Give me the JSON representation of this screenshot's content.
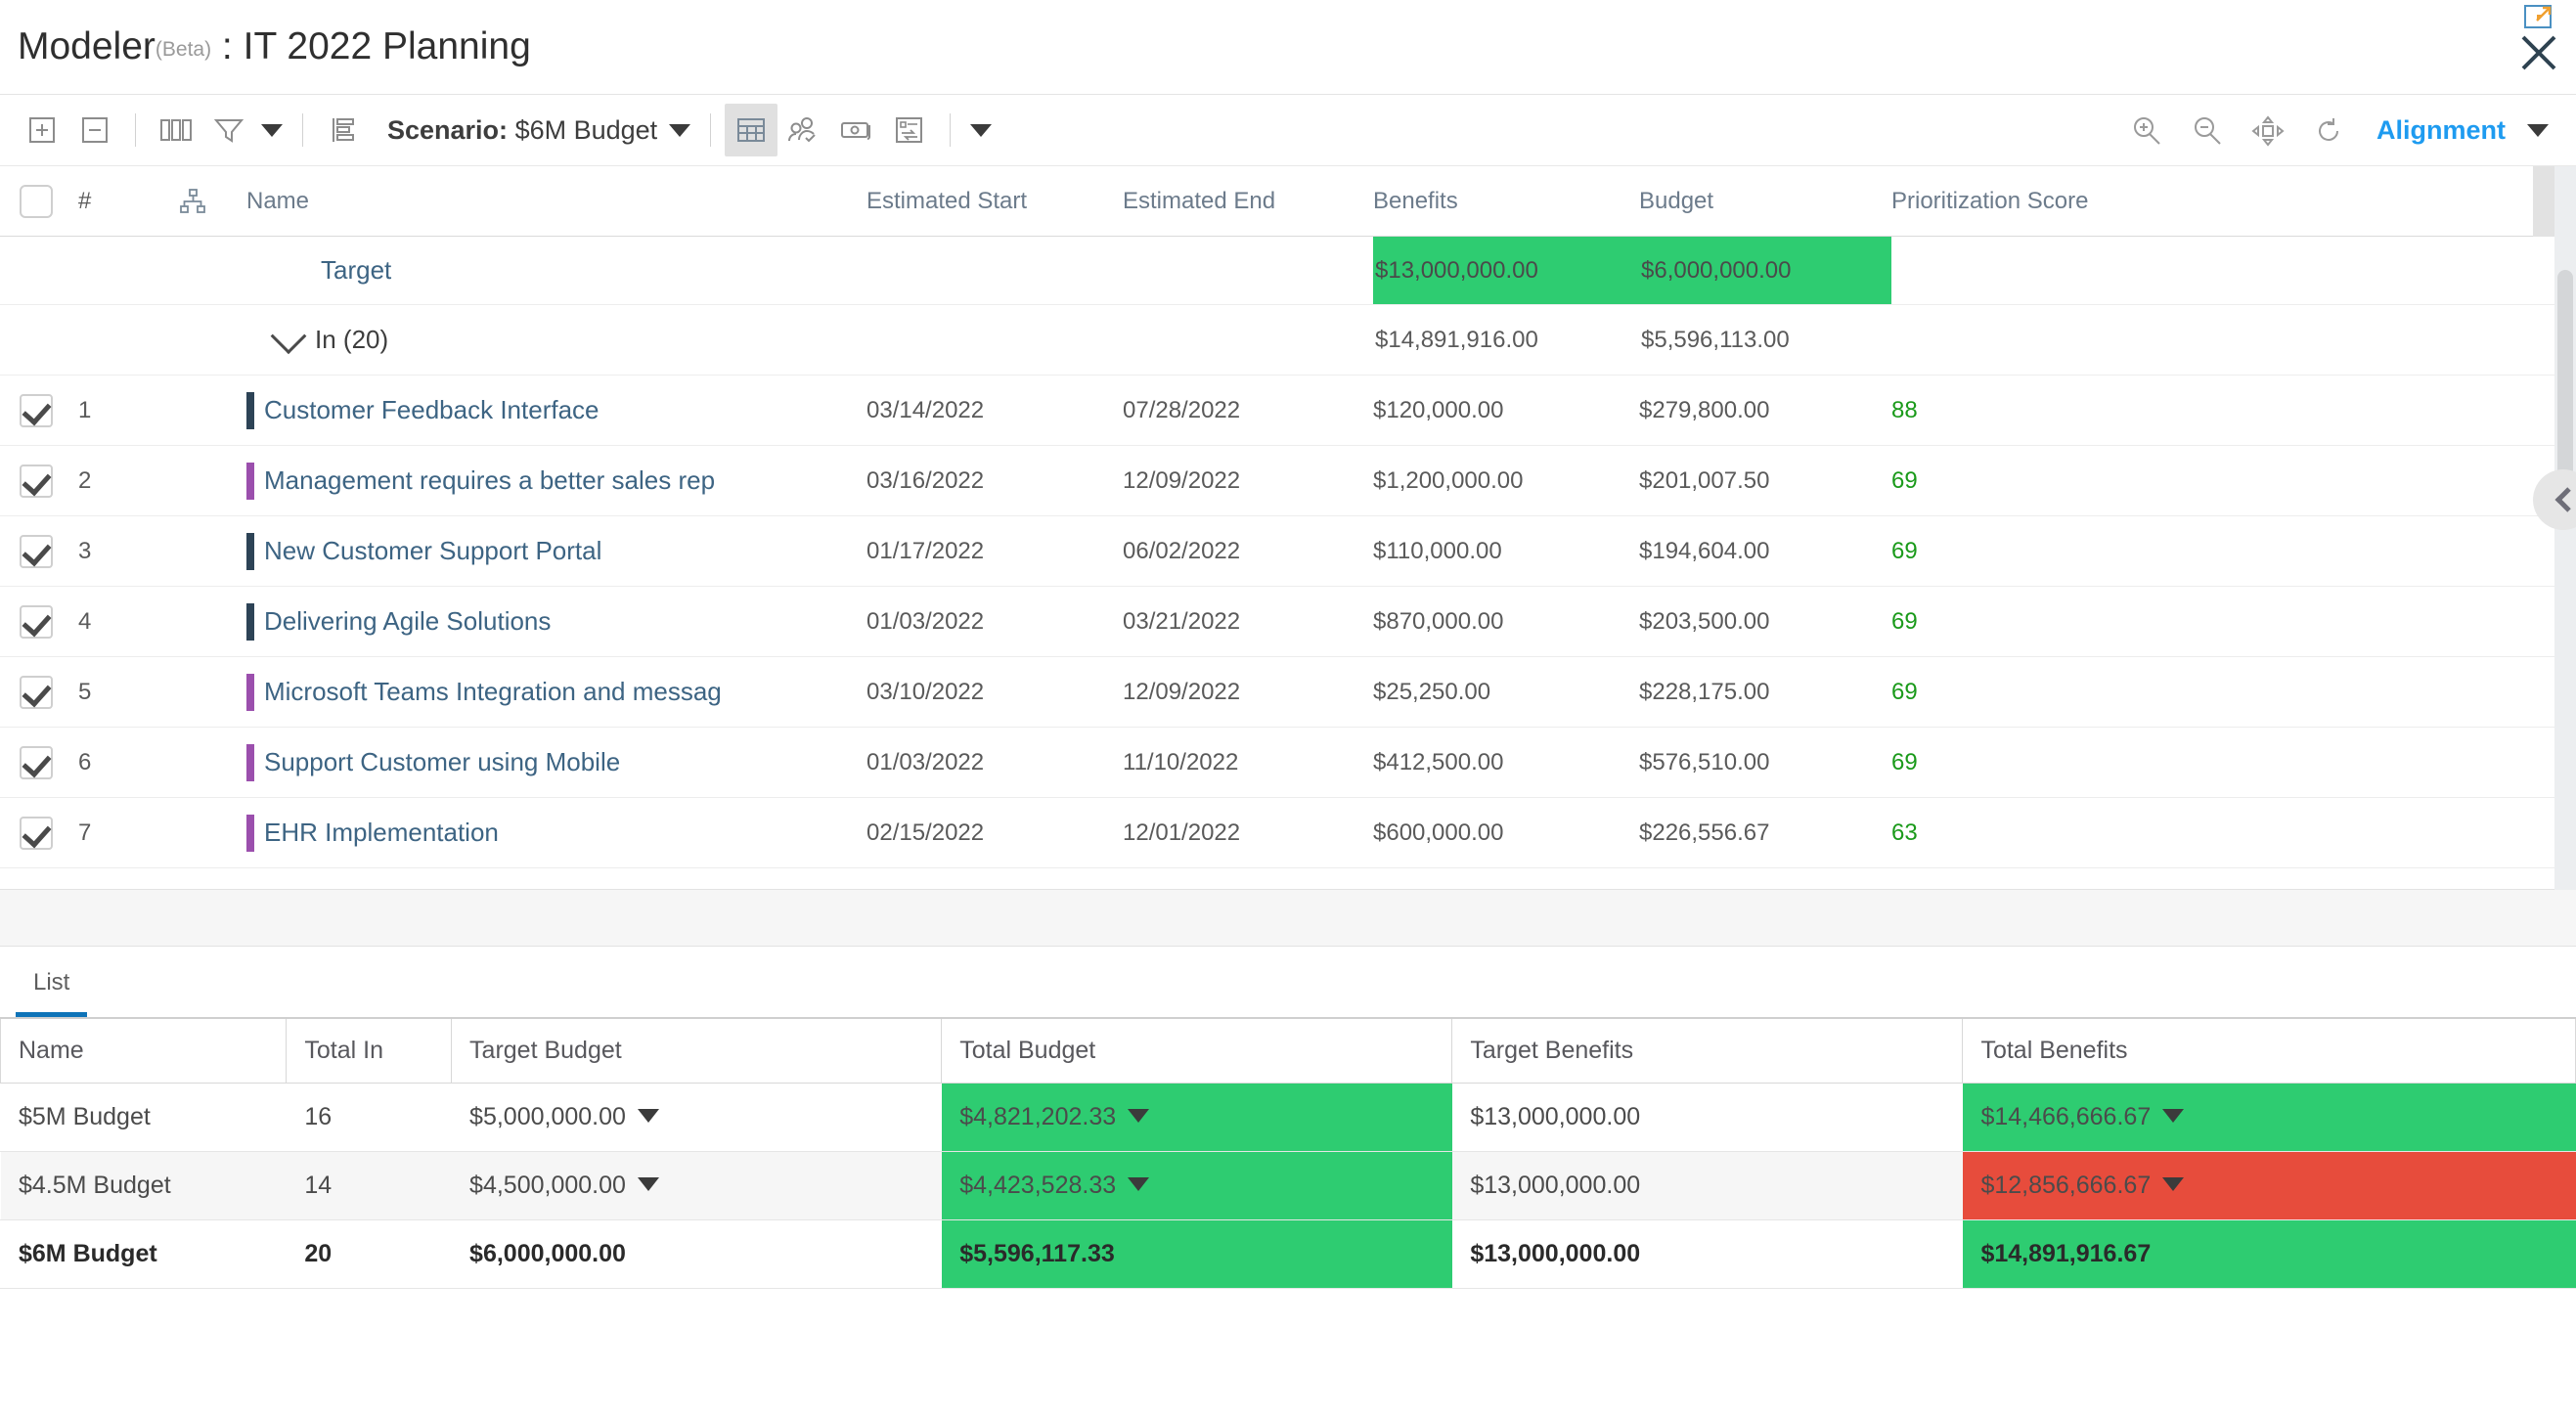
{
  "window": {
    "title_app": "Modeler",
    "title_beta": "(Beta)",
    "title_sep": " : ",
    "title_doc": "IT 2022 Planning",
    "popout_icon": "popout-icon",
    "close_icon": "close-icon"
  },
  "toolbar": {
    "expand_icon": "expand-plus-icon",
    "collapse_icon": "collapse-minus-icon",
    "columns_icon": "columns-icon",
    "filter_icon": "filter-icon",
    "filter_caret_icon": "chevron-down-icon",
    "outline_icon": "outline-list-icon",
    "scenario_label": "Scenario:",
    "scenario_value": "$6M Budget",
    "scenario_caret_icon": "chevron-down-icon",
    "view_table_icon": "table-view-icon",
    "view_resource_icon": "resource-people-icon",
    "view_money_icon": "money-icon",
    "view_swap_icon": "swap-board-icon",
    "view_more_caret_icon": "chevron-down-icon",
    "zoom_in_icon": "zoom-in-icon",
    "zoom_out_icon": "zoom-out-icon",
    "fit_icon": "fit-to-screen-icon",
    "refresh_icon": "refresh-icon",
    "alignment_label": "Alignment",
    "alignment_caret_icon": "chevron-down-icon"
  },
  "grid": {
    "columns": {
      "select": "",
      "number": "#",
      "hierarchy_icon": "hierarchy-icon",
      "name": "Name",
      "estimated_start": "Estimated Start",
      "estimated_end": "Estimated End",
      "benefits": "Benefits",
      "budget": "Budget",
      "prioritization_score": "Prioritization Score"
    },
    "target_row": {
      "label": "Target",
      "benefits": "$13,000,000.00",
      "budget": "$6,000,000.00",
      "highlight": "#2ecc71"
    },
    "group_row": {
      "expand_icon": "chevron-down-icon",
      "label": "In (20)",
      "benefits": "$14,891,916.00",
      "budget": "$5,596,113.00"
    },
    "rows": [
      {
        "checked": true,
        "num": "1",
        "color": "#2d4356",
        "name": "Customer Feedback Interface",
        "start": "03/14/2022",
        "end": "07/28/2022",
        "benefits": "$120,000.00",
        "budget": "$279,800.00",
        "score": "88"
      },
      {
        "checked": true,
        "num": "2",
        "color": "#9b4fad",
        "name": "Management requires a better sales rep",
        "start": "03/16/2022",
        "end": "12/09/2022",
        "benefits": "$1,200,000.00",
        "budget": "$201,007.50",
        "score": "69"
      },
      {
        "checked": true,
        "num": "3",
        "color": "#2d4356",
        "name": "New Customer Support Portal",
        "start": "01/17/2022",
        "end": "06/02/2022",
        "benefits": "$110,000.00",
        "budget": "$194,604.00",
        "score": "69"
      },
      {
        "checked": true,
        "num": "4",
        "color": "#2d4356",
        "name": "Delivering Agile Solutions",
        "start": "01/03/2022",
        "end": "03/21/2022",
        "benefits": "$870,000.00",
        "budget": "$203,500.00",
        "score": "69"
      },
      {
        "checked": true,
        "num": "5",
        "color": "#9b4fad",
        "name": "Microsoft Teams Integration and messag",
        "start": "03/10/2022",
        "end": "12/09/2022",
        "benefits": "$25,250.00",
        "budget": "$228,175.00",
        "score": "69"
      },
      {
        "checked": true,
        "num": "6",
        "color": "#9b4fad",
        "name": "Support Customer using Mobile",
        "start": "01/03/2022",
        "end": "11/10/2022",
        "benefits": "$412,500.00",
        "budget": "$576,510.00",
        "score": "69"
      },
      {
        "checked": true,
        "num": "7",
        "color": "#9b4fad",
        "name": "EHR Implementation",
        "start": "02/15/2022",
        "end": "12/01/2022",
        "benefits": "$600,000.00",
        "budget": "$226,556.67",
        "score": "63"
      }
    ],
    "collapse_handle_icon": "chevron-left-icon",
    "scrollbar": "vertical-scrollbar"
  },
  "bottom": {
    "tabs": [
      {
        "label": "List",
        "active": true
      }
    ],
    "columns": [
      "Name",
      "Total In",
      "Target Budget",
      "Total Budget",
      "Target Benefits",
      "Total Benefits"
    ],
    "rows": [
      {
        "name": "$5M Budget",
        "total_in": "16",
        "target_budget": "$5,000,000.00",
        "target_budget_marker": true,
        "total_budget": "$4,821,202.33",
        "total_budget_marker": true,
        "total_budget_color": "green",
        "target_benefits": "$13,000,000.00",
        "target_benefits_marker": false,
        "total_benefits": "$14,466,666.67",
        "total_benefits_marker": true,
        "total_benefits_color": "green",
        "bold": false,
        "alt": false
      },
      {
        "name": "$4.5M Budget",
        "total_in": "14",
        "target_budget": "$4,500,000.00",
        "target_budget_marker": true,
        "total_budget": "$4,423,528.33",
        "total_budget_marker": true,
        "total_budget_color": "green",
        "target_benefits": "$13,000,000.00",
        "target_benefits_marker": false,
        "total_benefits": "$12,856,666.67",
        "total_benefits_marker": true,
        "total_benefits_color": "red",
        "bold": false,
        "alt": true
      },
      {
        "name": "$6M Budget",
        "total_in": "20",
        "target_budget": "$6,000,000.00",
        "target_budget_marker": false,
        "total_budget": "$5,596,117.33",
        "total_budget_marker": false,
        "total_budget_color": "green",
        "target_benefits": "$13,000,000.00",
        "target_benefits_marker": false,
        "total_benefits": "$14,891,916.67",
        "total_benefits_marker": false,
        "total_benefits_color": "green",
        "bold": true,
        "alt": false
      }
    ]
  },
  "colors": {
    "accent_blue": "#1e9bf0",
    "tab_underline": "#0e73b8",
    "positive_green": "#2ecc71",
    "negative_red": "#e74c3c",
    "score_green": "#1a9a1a",
    "link_blue": "#3d6483"
  }
}
